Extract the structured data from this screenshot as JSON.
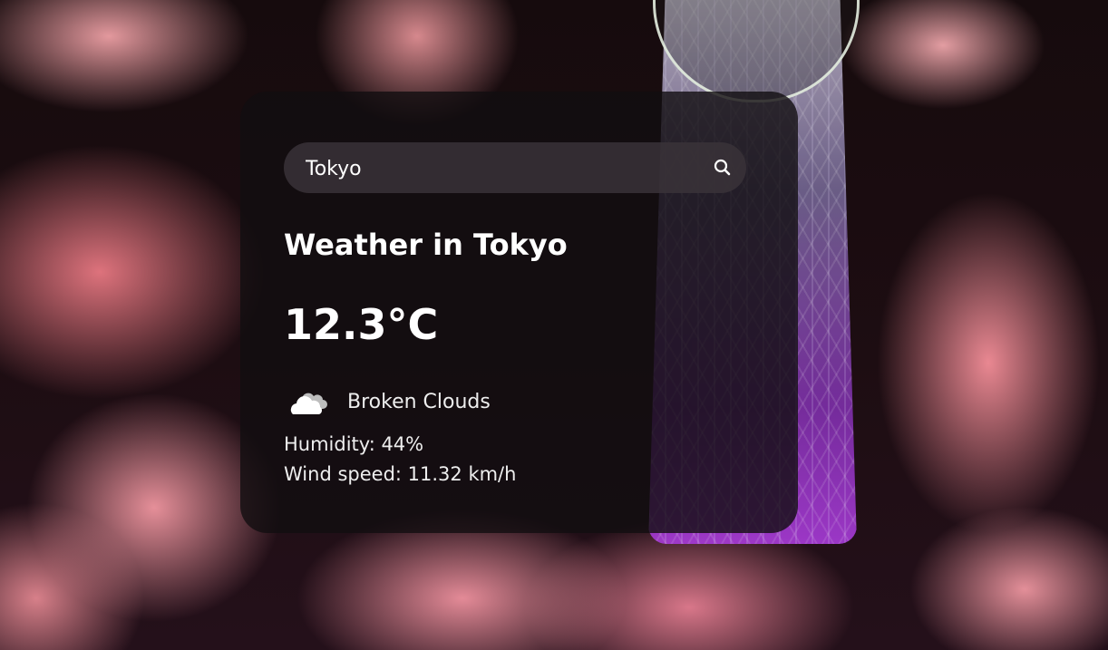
{
  "search": {
    "value": "Tokyo",
    "icon": "search-icon"
  },
  "weather": {
    "title": "Weather in Tokyo",
    "temperature": "12.3°C",
    "condition_icon": "broken-clouds-icon",
    "condition": "Broken Clouds",
    "humidity": "Humidity: 44%",
    "wind": "Wind speed: 11.32 km/h"
  }
}
